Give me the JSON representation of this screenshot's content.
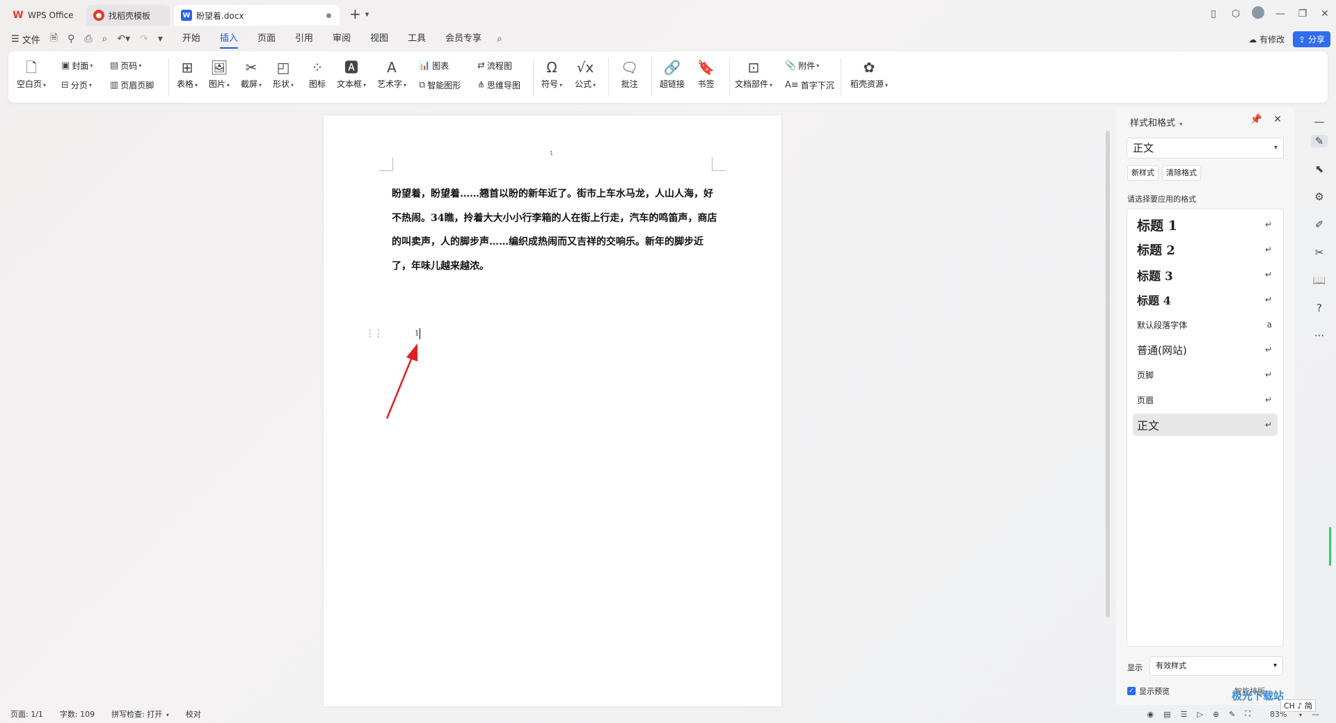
{
  "tabs": {
    "wps": "WPS Office",
    "template": "找稻壳模板",
    "doc": "盼望着.docx"
  },
  "menu": {
    "file": "文件",
    "items": [
      "开始",
      "插入",
      "页面",
      "引用",
      "审阅",
      "视图",
      "工具",
      "会员专享"
    ],
    "active": "插入",
    "changes": "有修改",
    "share": "分享"
  },
  "ribbon": {
    "blank_page": "空白页",
    "cover": "封面",
    "page_break": "分页",
    "page_number": "页码",
    "header_footer": "页眉页脚",
    "table": "表格",
    "picture": "图片",
    "screenshot": "截屏",
    "shape": "形状",
    "icon": "图标",
    "textbox": "文本框",
    "wordart": "艺术字",
    "chart": "图表",
    "smart_graphic": "智能图形",
    "flowchart": "流程图",
    "mindmap": "思维导图",
    "symbol": "符号",
    "formula": "公式",
    "comment": "批注",
    "hyperlink": "超链接",
    "bookmark": "书签",
    "doc_parts": "文档部件",
    "attachment": "附件",
    "drop_cap": "首字下沉",
    "docer_resource": "稻壳资源"
  },
  "document": {
    "header_number": "1",
    "paragraph": "盼望着，盼望着……翘首以盼的新年近了。街市上车水马龙，人山人海，好不热闹。34瞧，拎着大大小小行李箱的人在街上行走，汽车的鸣笛声，商店的叫卖声，人的脚步声……编织成热闹而又吉祥的交响乐。新年的脚步近了，年味儿越来越浓。",
    "cursor_line": "1"
  },
  "panel": {
    "title": "样式和格式",
    "current_style": "正文",
    "new_style": "新样式",
    "clear_format": "清除格式",
    "apply_label": "请选择要应用的格式",
    "styles": [
      "标题 1",
      "标题 2",
      "标题 3",
      "标题 4",
      "默认段落字体",
      "普通(网站)",
      "页脚",
      "页眉",
      "正文"
    ],
    "selected_style": "正文",
    "show_label": "显示",
    "show_value": "有效样式",
    "preview_label": "显示预览",
    "smart_layout": "智能排版"
  },
  "status": {
    "page": "页面: 1/1",
    "words": "字数: 109",
    "spell": "拼写检查: 打开",
    "proof": "校对",
    "zoom": "83%"
  },
  "watermark": "极光下载站",
  "ime": "CH ♪ 简",
  "colors": {
    "accent": "#2357e8",
    "share_bg": "#2f6cf0",
    "arrow": "#e02020"
  }
}
